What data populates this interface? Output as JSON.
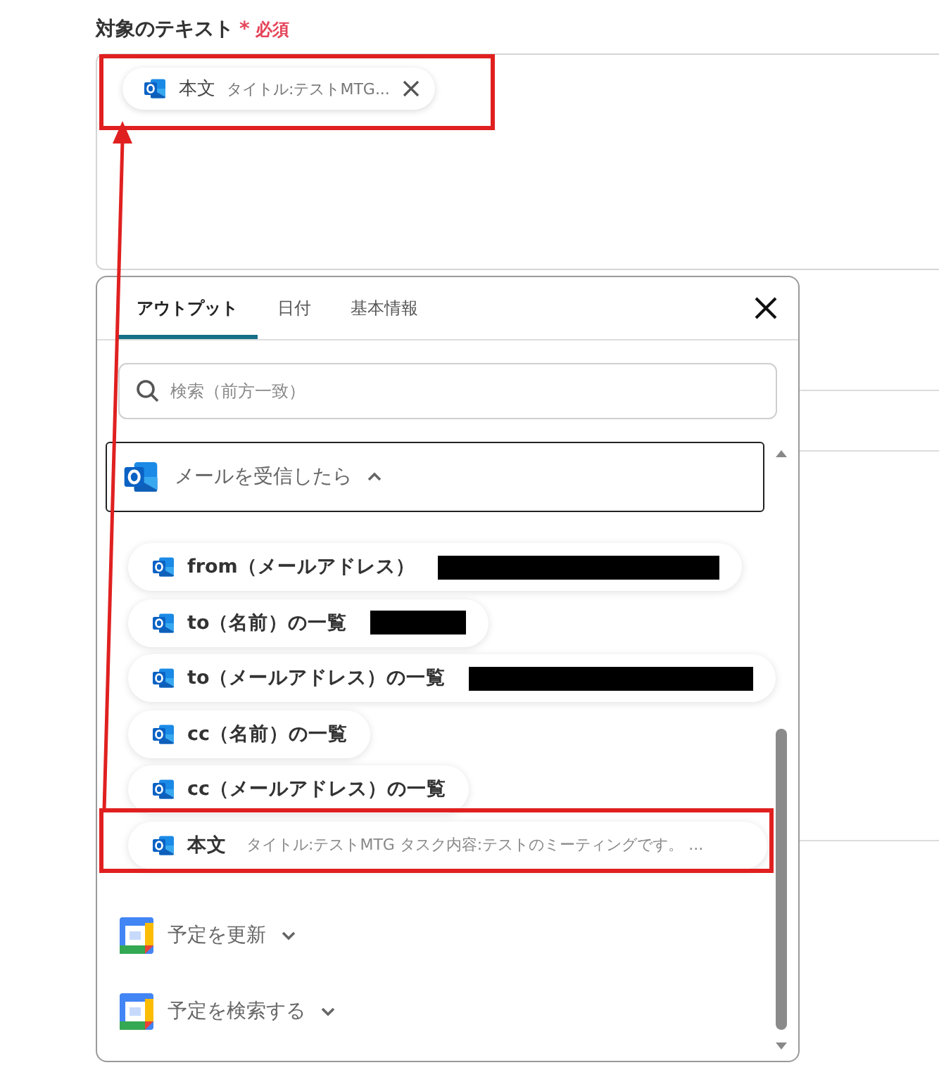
{
  "field": {
    "label": "対象のテキスト",
    "required_mark": "*",
    "required_text": "必須",
    "chip": {
      "name": "本文",
      "value": "タイトル:テストMTG...",
      "highlighted": true
    }
  },
  "popup": {
    "tabs": [
      {
        "label": "アウトプット",
        "selected": true
      },
      {
        "label": "日付",
        "selected": false
      },
      {
        "label": "基本情報",
        "selected": false
      }
    ],
    "search": {
      "placeholder": "検索（前方一致）"
    },
    "sections": [
      {
        "title": "メールを受信したら",
        "kind": "outlook",
        "expanded": true,
        "items": [
          {
            "name": "from（メールアドレス）",
            "redacted": true,
            "highlighted": false
          },
          {
            "name": "to（名前）の一覧",
            "redacted": true,
            "highlighted": false
          },
          {
            "name": "to（メールアドレス）の一覧",
            "redacted": true,
            "highlighted": false
          },
          {
            "name": "cc（名前）の一覧",
            "redacted": false,
            "highlighted": false
          },
          {
            "name": "cc（メールアドレス）の一覧",
            "redacted": false,
            "highlighted": false
          },
          {
            "name": "本文",
            "value": "タイトル:テストMTG タスク内容:テストのミーティングです。 ...",
            "redacted": false,
            "highlighted": true
          }
        ]
      },
      {
        "title": "予定を更新",
        "kind": "calendar",
        "expanded": false
      },
      {
        "title": "予定を検索する",
        "kind": "calendar",
        "expanded": false
      }
    ]
  }
}
